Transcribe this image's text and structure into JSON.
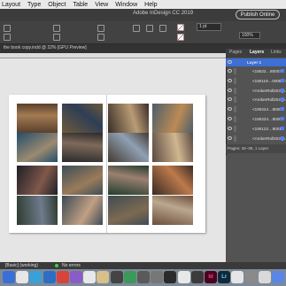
{
  "menubar": {
    "items": [
      "Layout",
      "Type",
      "Object",
      "Table",
      "View",
      "Window",
      "Help"
    ]
  },
  "app": {
    "title": "Adobe InDesign CC 2019",
    "publish_label": "Publish Online"
  },
  "controls": {
    "zoom": "100%",
    "stroke": "1 pt"
  },
  "document": {
    "tab_label": "the book copy.indd @ 22% [GPU Preview]"
  },
  "panel": {
    "tabs": [
      "Pages",
      "Layers",
      "Links"
    ],
    "active_tab": "Layers",
    "layer_header": "Layer 1",
    "items": [
      "<19022…8000>",
      "<190119…0005 2>",
      "<AmberRoll203.jp…>",
      "<AmberRoll204.jp…>",
      "<190224…8000>",
      "<190224…8000>",
      "<190122…8001>",
      "<AmberRoll203.jp…>"
    ],
    "footer": "Pages: 34–35, 1 Layer"
  },
  "status": {
    "page_field": "[Basic] (working)",
    "preflight": "No errors"
  },
  "photos": [
    {
      "colors": [
        "#5a3f2d",
        "#a37b52"
      ]
    },
    {
      "colors": [
        "#6e5a3c",
        "#2f3e55"
      ]
    },
    {
      "colors": [
        "#3a2d27",
        "#b99c75"
      ]
    },
    {
      "colors": [
        "#4c5e6a",
        "#bb8a55"
      ]
    },
    {
      "colors": [
        "#234e6b",
        "#9a8a70"
      ]
    },
    {
      "colors": [
        "#2b2a2a",
        "#7e6a5b"
      ]
    },
    {
      "colors": [
        "#433a32",
        "#8fa0b3"
      ]
    },
    {
      "colors": [
        "#5b4a40",
        "#d0b690"
      ]
    },
    {
      "colors": [
        "#1f1f27",
        "#80584a"
      ]
    },
    {
      "colors": [
        "#3c4e58",
        "#9a7b5a"
      ]
    },
    {
      "colors": [
        "#233d2e",
        "#9b8070"
      ]
    },
    {
      "colors": [
        "#3a2a25",
        "#bd7a4b"
      ]
    },
    {
      "colors": [
        "#2d3b2f",
        "#6f7a8c"
      ]
    },
    {
      "colors": [
        "#3b4a55",
        "#c1a084"
      ]
    },
    {
      "colors": [
        "#414b52",
        "#7c6a52"
      ]
    },
    {
      "colors": [
        "#6b4e3b",
        "#bba78f"
      ]
    },
    {
      "colors": [
        "#455a66",
        "#d9d2c5"
      ]
    },
    {
      "colors": [
        "#2e3a42",
        "#866a4b"
      ]
    },
    {
      "colors": [
        "#5a6a6e",
        "#bba27b"
      ]
    },
    {
      "colors": [
        "#2a5a3a",
        "#8a7a60"
      ]
    }
  ],
  "dock": [
    {
      "label": "",
      "color": "#3b6fd8",
      "text": "#fff"
    },
    {
      "label": "",
      "color": "#e6e6e6",
      "text": "#333"
    },
    {
      "label": "",
      "color": "#3aa0d8",
      "text": "#fff"
    },
    {
      "label": "",
      "color": "#2e6dc4",
      "text": "#fff"
    },
    {
      "label": "",
      "color": "#d8433b",
      "text": "#fff"
    },
    {
      "label": "",
      "color": "#8a5cc8",
      "text": "#fff"
    },
    {
      "label": "",
      "color": "#e8e8e8",
      "text": "#333"
    },
    {
      "label": "",
      "color": "#d7c08a",
      "text": "#333"
    },
    {
      "label": "",
      "color": "#444",
      "text": "#fff"
    },
    {
      "label": "",
      "color": "#3b9a5a",
      "text": "#fff"
    },
    {
      "label": "",
      "color": "#5a5a5a",
      "text": "#fff"
    },
    {
      "label": "",
      "color": "#777",
      "text": "#fff"
    },
    {
      "label": "",
      "color": "#2b2b2b",
      "text": "#f5a623"
    },
    {
      "label": "",
      "color": "#e8e8e8",
      "text": "#333"
    },
    {
      "label": "",
      "color": "#3b3b3b",
      "text": "#e58fff"
    },
    {
      "label": "Id",
      "color": "#49021f",
      "text": "#ff3f8f"
    },
    {
      "label": "Lr",
      "color": "#0c2a3b",
      "text": "#7ec6ee"
    },
    {
      "label": "",
      "color": "#e5e5e5",
      "text": "#333"
    },
    {
      "label": "",
      "color": "#8a8a8a",
      "text": "#fff"
    },
    {
      "label": "",
      "color": "#d9d9d9",
      "text": "#333"
    },
    {
      "label": "",
      "color": "#5b86e5",
      "text": "#fff"
    }
  ]
}
